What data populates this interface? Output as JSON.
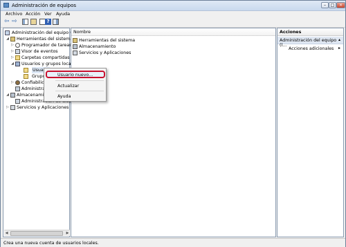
{
  "window": {
    "title": "Administración de equipos"
  },
  "menu": [
    "Archivo",
    "Acción",
    "Ver",
    "Ayuda"
  ],
  "tree": {
    "root": "Administración del equipo (loc",
    "system_tools": "Herramientas del sistema",
    "task_scheduler": "Programador de tareas",
    "event_viewer": "Visor de eventos",
    "shared_folders": "Carpetas compartidas",
    "local_users": "Usuarios y grupos locale",
    "users": "Usuario",
    "groups": "Grupo",
    "reliability": "Confiabilid",
    "device_manager": "Administra",
    "storage": "Almacenamien",
    "disk_management": "Administración de disc",
    "services": "Servicios y Aplicaciones"
  },
  "center": {
    "column_header": "Nombre",
    "items": [
      "Herramientas del sistema",
      "Almacenamiento",
      "Servicios y Aplicaciones"
    ]
  },
  "actions": {
    "header": "Acciones",
    "section": "Administración del equipo (l...",
    "more": "Acciones adicionales"
  },
  "context_menu": {
    "new_user": "Usuario nuevo...",
    "refresh": "Actualizar",
    "help": "Ayuda"
  },
  "status": "Crea una nueva cuenta de usuarios locales.",
  "colors": {
    "highlight_ring": "#c8102e",
    "title_bar": "#c9d9ee"
  }
}
